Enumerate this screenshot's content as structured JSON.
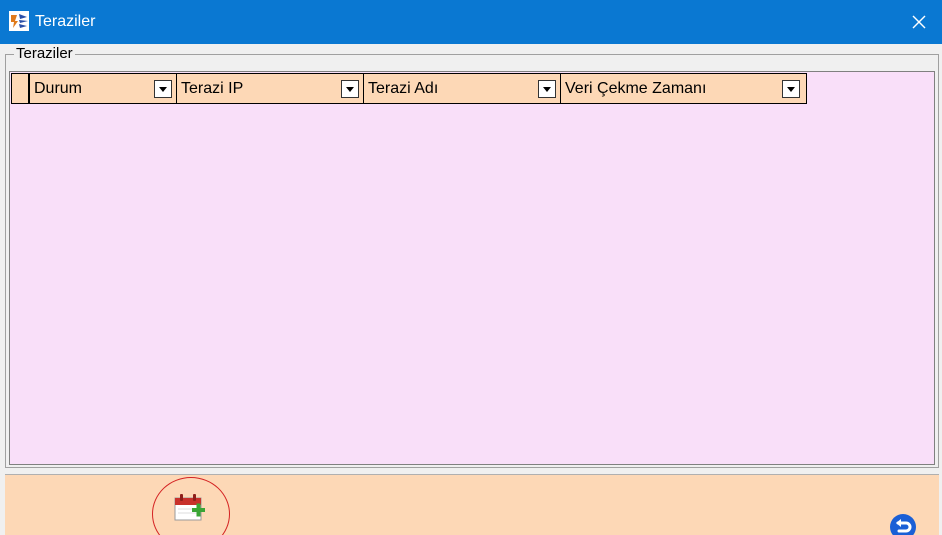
{
  "window": {
    "title": "Teraziler",
    "app_icon": "app-logo-icon",
    "close_icon": "close-icon"
  },
  "group": {
    "legend": "Teraziler"
  },
  "grid": {
    "columns": [
      {
        "label": "Durum"
      },
      {
        "label": "Terazi IP"
      },
      {
        "label": "Terazi Adı"
      },
      {
        "label": "Veri Çekme Zamanı"
      }
    ],
    "rows": [],
    "background": "#f9dff9",
    "header_background": "#fdd8b6"
  },
  "footer": {
    "add_icon": "calendar-add-icon",
    "back_icon": "back-arrow-icon",
    "background": "#fdd8b6"
  },
  "colors": {
    "titlebar": "#0a78d2",
    "highlight_circle": "#d42222",
    "back_icon": "#1a5fd6"
  }
}
